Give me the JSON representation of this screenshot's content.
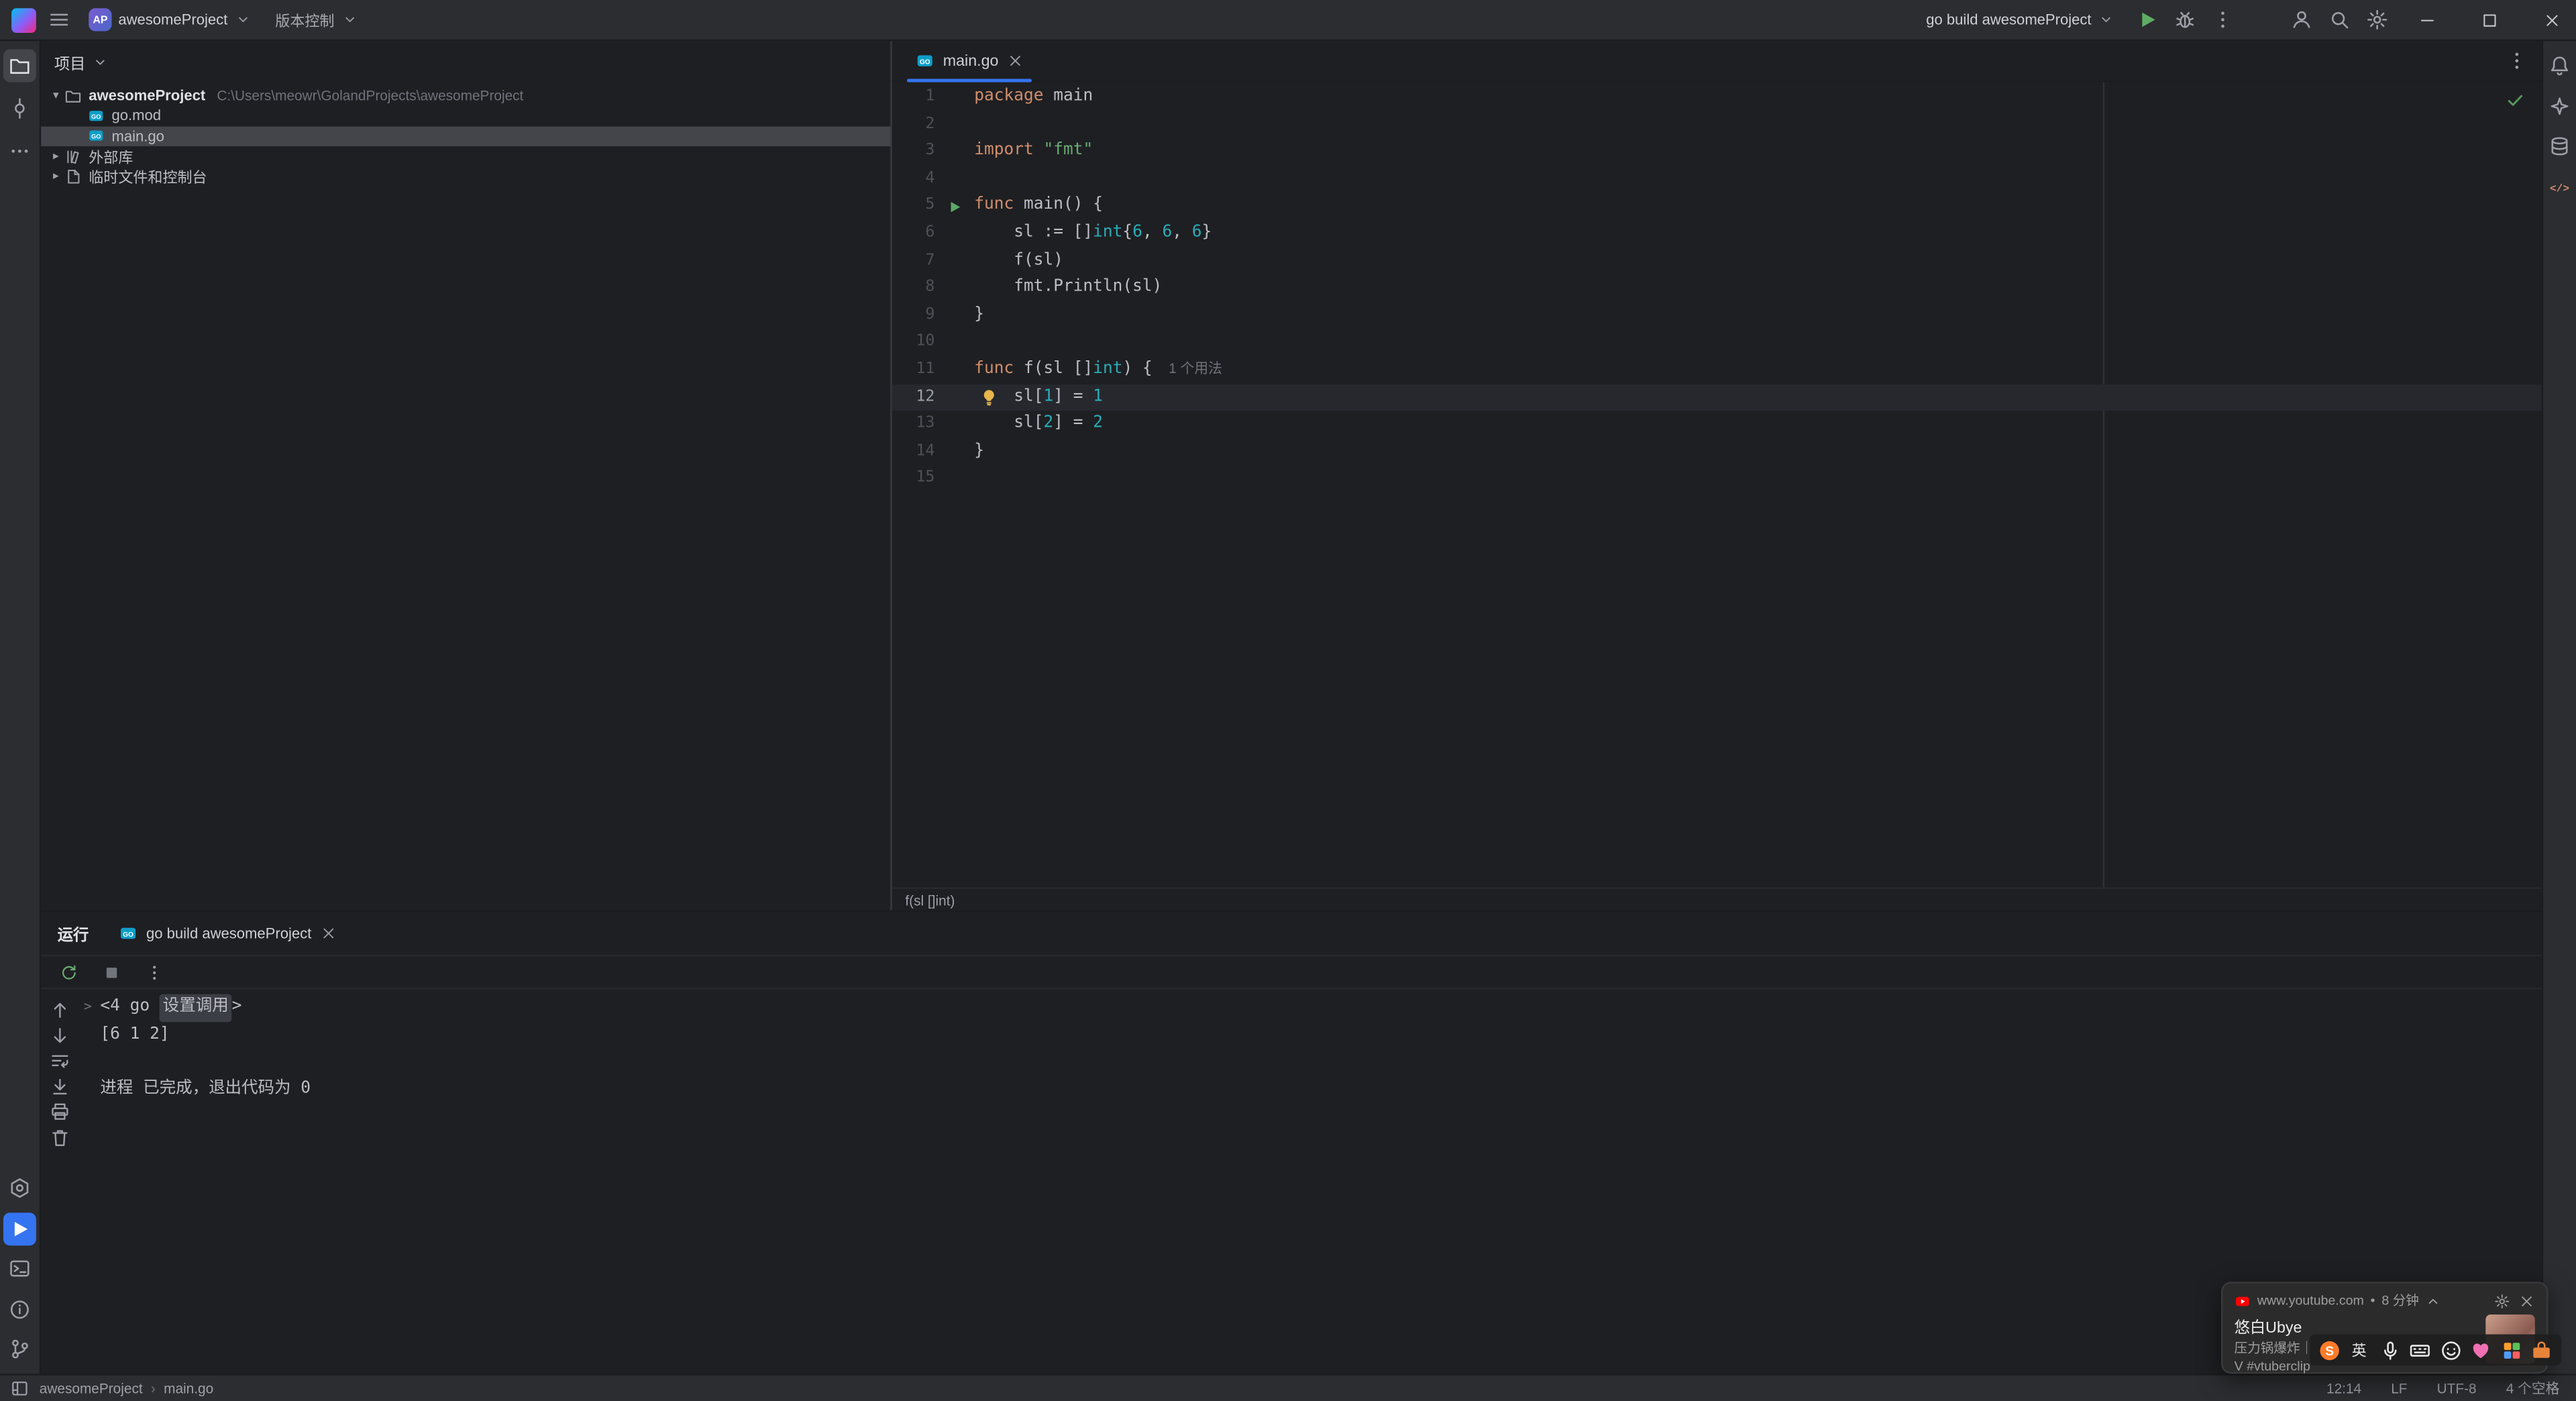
{
  "colors": {
    "accent": "#3574f0",
    "chrome_bg": "#2b2d30",
    "editor_bg": "#1e1f22",
    "run_green": "#59a869",
    "keyword": "#cf8e6d",
    "string": "#6aab73",
    "number": "#2aacb8"
  },
  "titlebar": {
    "project_badge": "AP",
    "project_name": "awesomeProject",
    "vcs_widget": "版本控制",
    "run_config": "go build awesomeProject"
  },
  "left_stripe": {
    "top": [
      {
        "name": "project-tool-button",
        "icon": "folder",
        "active": true
      },
      {
        "name": "commit-tool-button",
        "icon": "commit"
      },
      {
        "name": "more-tool-windows-button",
        "icon": "more-h"
      }
    ],
    "bottom": [
      {
        "name": "services-tool-button",
        "icon": "services"
      },
      {
        "name": "run-tool-button",
        "icon": "play",
        "accent": true
      },
      {
        "name": "terminal-tool-button",
        "icon": "terminal"
      },
      {
        "name": "problems-tool-button",
        "icon": "info"
      },
      {
        "name": "vcs-branch-tool-button",
        "icon": "branch"
      }
    ]
  },
  "right_stripe": {
    "top": [
      {
        "name": "notifications-button",
        "icon": "bell"
      },
      {
        "name": "ai-assistant-button",
        "icon": "sparkle"
      },
      {
        "name": "database-button",
        "icon": "database"
      },
      {
        "name": "endpoints-button",
        "icon": "code-tag",
        "color": "#cf8e6d"
      }
    ]
  },
  "project_panel": {
    "title": "项目",
    "items": [
      {
        "name": "awesomeProject",
        "path": "C:\\Users\\meowr\\GolandProjects\\awesomeProject",
        "icon": "folder",
        "chevron": "down",
        "indent": 0,
        "bold": true
      },
      {
        "name": "go.mod",
        "icon": "go-file",
        "indent": 1
      },
      {
        "name": "main.go",
        "icon": "go-file",
        "indent": 1,
        "selected": true
      },
      {
        "name": "外部库",
        "icon": "lib",
        "chevron": "right",
        "indent": 0
      },
      {
        "name": "临时文件和控制台",
        "icon": "scratch",
        "chevron": "right",
        "indent": 0
      }
    ]
  },
  "editor": {
    "tab": {
      "label": "main.go"
    },
    "breadcrumb": "f(sl []int)",
    "lines": [
      {
        "n": 1,
        "tokens": [
          [
            "kw",
            "package"
          ],
          [
            "def",
            " main"
          ]
        ]
      },
      {
        "n": 2
      },
      {
        "n": 3,
        "tokens": [
          [
            "kw",
            "import"
          ],
          [
            "def",
            " "
          ],
          [
            "str",
            "\"fmt\""
          ]
        ]
      },
      {
        "n": 4
      },
      {
        "n": 5,
        "run": true,
        "tokens": [
          [
            "kw",
            "func"
          ],
          [
            "def",
            " main() {"
          ]
        ]
      },
      {
        "n": 6,
        "tokens": [
          [
            "def",
            "    sl := []"
          ],
          [
            "typ",
            "int"
          ],
          [
            "def",
            "{"
          ],
          [
            "num",
            "6"
          ],
          [
            "def",
            ", "
          ],
          [
            "num",
            "6"
          ],
          [
            "def",
            ", "
          ],
          [
            "num",
            "6"
          ],
          [
            "def",
            "}"
          ]
        ]
      },
      {
        "n": 7,
        "tokens": [
          [
            "def",
            "    f(sl)"
          ]
        ]
      },
      {
        "n": 8,
        "tokens": [
          [
            "def",
            "    fmt.Println(sl)"
          ]
        ]
      },
      {
        "n": 9,
        "tokens": [
          [
            "def",
            "}"
          ]
        ]
      },
      {
        "n": 10
      },
      {
        "n": 11,
        "tokens": [
          [
            "kw",
            "func"
          ],
          [
            "def",
            " f(sl []"
          ],
          [
            "typ",
            "int"
          ],
          [
            "def",
            ") {"
          ]
        ],
        "hint": "1 个用法"
      },
      {
        "n": 12,
        "caret": true,
        "bulb": true,
        "tokens": [
          [
            "def",
            "    sl["
          ],
          [
            "num",
            "1"
          ],
          [
            "def",
            "] = "
          ],
          [
            "num",
            "1"
          ]
        ]
      },
      {
        "n": 13,
        "tokens": [
          [
            "def",
            "    sl["
          ],
          [
            "num",
            "2"
          ],
          [
            "def",
            "] = "
          ],
          [
            "num",
            "2"
          ]
        ]
      },
      {
        "n": 14,
        "tokens": [
          [
            "def",
            "}"
          ]
        ]
      },
      {
        "n": 15
      }
    ]
  },
  "run_panel": {
    "title": "运行",
    "tab": {
      "label": "go build awesomeProject"
    },
    "toolbar": [
      {
        "name": "rerun-button",
        "icon": "rerun",
        "color": "#6aab73"
      },
      {
        "name": "stop-button",
        "icon": "stop",
        "color": "#71757c"
      },
      {
        "name": "console-more-button",
        "icon": "more-v"
      }
    ],
    "gutter": [
      {
        "name": "prev-occurrence-button",
        "icon": "arrow-up"
      },
      {
        "name": "next-occurrence-button",
        "icon": "arrow-down"
      },
      {
        "name": "soft-wrap-button",
        "icon": "soft-wrap"
      },
      {
        "name": "scroll-to-end-button",
        "icon": "scroll-end"
      },
      {
        "name": "print-button",
        "icon": "print"
      },
      {
        "name": "clear-all-button",
        "icon": "trash"
      }
    ],
    "console": [
      {
        "fold": true,
        "prefix": "<4 go ",
        "chip": "设置调用",
        "suffix": ">"
      },
      {
        "text": "[6 1 2]"
      },
      {
        "text": ""
      },
      {
        "text": "进程 已完成，退出代码为 0"
      }
    ]
  },
  "status_bar": {
    "crumbs": [
      "awesomeProject",
      "main.go"
    ],
    "right": [
      "12:14",
      "LF",
      "UTF-8",
      "4 个空格"
    ]
  },
  "notification": {
    "source": "www.youtube.com",
    "separator": "•",
    "time": "8 分钟",
    "title": "悠白Ubye",
    "line2": "压力锅爆炸｜",
    "line3": "V #vtuberclip"
  },
  "ime_bar": {
    "items": [
      {
        "name": "sogou-logo-icon",
        "icon": "sogou"
      },
      {
        "name": "ime-lang-mode",
        "text": "英"
      },
      {
        "name": "ime-mic-icon",
        "icon": "mic"
      },
      {
        "name": "ime-keyboard-icon",
        "icon": "keyboard"
      },
      {
        "name": "ime-emoji-icon",
        "icon": "emoji"
      },
      {
        "name": "ime-skin-icon",
        "icon": "heart"
      },
      {
        "name": "ime-apps-grid-icon",
        "icon": "grid-colors"
      },
      {
        "name": "ime-toolbox-icon",
        "icon": "toolbox"
      }
    ]
  }
}
